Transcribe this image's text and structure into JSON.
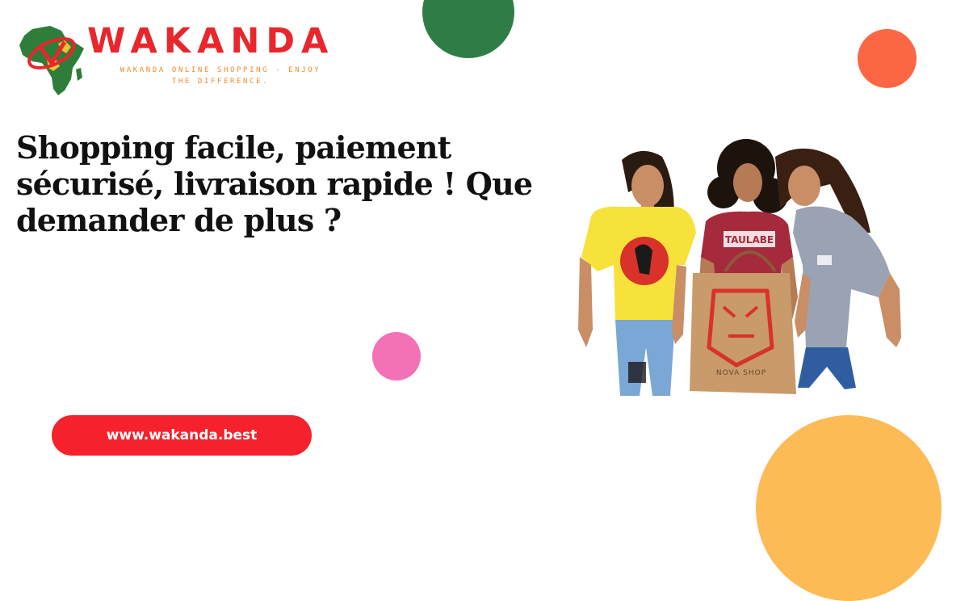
{
  "brand": {
    "name": "WAKANDA",
    "tagline_line1": "WAKANDA ONLINE SHOPPING - ENJOY",
    "tagline_line2": "THE DIFFERENCE."
  },
  "headline": "Shopping facile, paiement sécurisé, livraison rapide ! Que demander de plus ?",
  "website_button": {
    "label": "www.wakanda.best"
  },
  "photo": {
    "shirt_text_left": "TAULABE",
    "bag_text": "NOVA SHOP"
  },
  "colors": {
    "brand_red": "#e8262b",
    "tagline_orange": "#f28b2b",
    "green_circle": "#2e7d46",
    "orange_circle": "#fb6744",
    "pink_circle": "#f371b7",
    "yellow_circle": "#fdbb55",
    "button_red": "#f5222d"
  },
  "icons": {
    "logo_map": "africa-map-icon"
  }
}
